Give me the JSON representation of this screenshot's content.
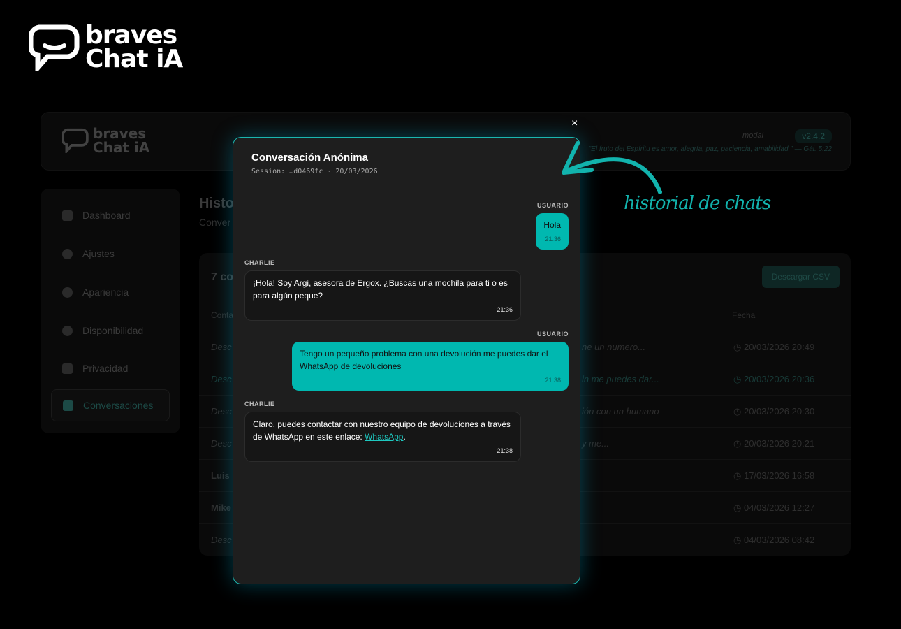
{
  "brand": {
    "line1": "braves",
    "line2": "Chat iA"
  },
  "header": {
    "mode_label": "modal",
    "version": "v2.4.2",
    "quote": "\"El fruto del Espíritu es amor, alegría, paz, paciencia, amabilidad.\" — Gál. 5:22"
  },
  "sidebar": {
    "items": [
      {
        "label": "Dashboard"
      },
      {
        "label": "Ajustes"
      },
      {
        "label": "Apariencia"
      },
      {
        "label": "Disponibilidad"
      },
      {
        "label": "Privacidad"
      },
      {
        "label": "Conversaciones"
      }
    ]
  },
  "main": {
    "title": "Histo",
    "subtitle": "Conver",
    "count": "7 co",
    "csv_button": "Descargar CSV",
    "col_contact": "Conta",
    "col_date": "Fecha",
    "rows": [
      {
        "c1": "Desc",
        "c2": "ne un numero...",
        "date": "20/03/2026 20:49"
      },
      {
        "c1": "Desc",
        "c2": "in me puedes dar...",
        "date": "20/03/2026 20:36"
      },
      {
        "c1": "Desc",
        "c2": "ión con un humano",
        "date": "20/03/2026 20:30"
      },
      {
        "c1": "Desc",
        "c2": "y me...",
        "date": "20/03/2026 20:21"
      },
      {
        "c1": "Luis",
        "c2": "",
        "date": "17/03/2026 16:58"
      },
      {
        "c1": "Mike",
        "c2": "",
        "date": "04/03/2026 12:27"
      },
      {
        "c1": "Desc",
        "c2": "",
        "date": "04/03/2026 08:42"
      }
    ]
  },
  "modal": {
    "title": "Conversación Anónima",
    "session": "Session: …d0469fc · 20/03/2026",
    "close": "×",
    "messages": [
      {
        "sender": "USUARIO",
        "text": "Hola",
        "time": "21:36"
      },
      {
        "sender": "CHARLIE",
        "text": "¡Hola! Soy Argi, asesora de Ergox. ¿Buscas una mochila para ti o es para algún peque?",
        "time": "21:36"
      },
      {
        "sender": "USUARIO",
        "text": "Tengo un pequeño problema con una devolución me puedes dar el WhatsApp de devoluciones",
        "time": "21:38"
      },
      {
        "sender": "CHARLIE",
        "text": "Claro, puedes contactar con nuestro equipo de devoluciones a través de WhatsApp en este enlace: ",
        "link": "WhatsApp",
        "after": ".",
        "time": "21:38"
      }
    ]
  },
  "annotation": "historial de chats",
  "colors": {
    "accent": "#00b8b0",
    "bg": "#000000",
    "modal_bg": "#1e1e1e"
  }
}
